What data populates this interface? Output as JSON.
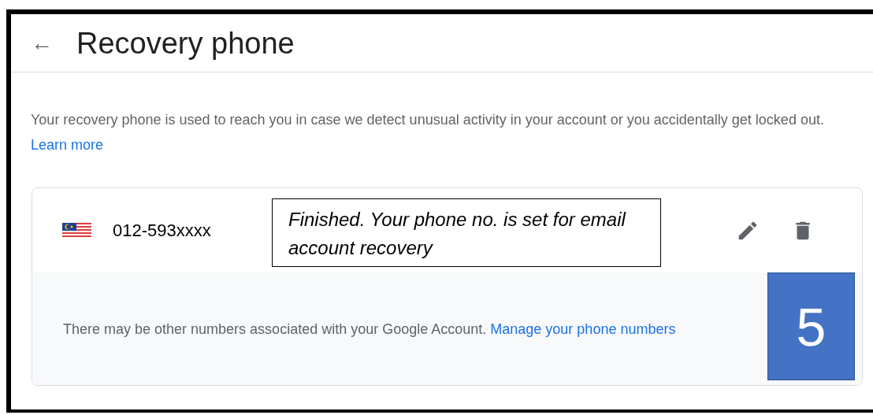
{
  "header": {
    "back_icon": "←",
    "title": "Recovery phone"
  },
  "description": {
    "text": "Your recovery phone is used to reach you in case we detect unusual activity in your account or you accidentally get locked out.",
    "link": "Learn more"
  },
  "phone": {
    "number": "012-593xxxx"
  },
  "callout": {
    "text": "Finished. Your phone no. is set for email account recovery"
  },
  "note": {
    "text": "There may be other numbers associated with your Google Account.",
    "link": "Manage your phone numbers"
  },
  "step_badge": {
    "label": "5"
  }
}
